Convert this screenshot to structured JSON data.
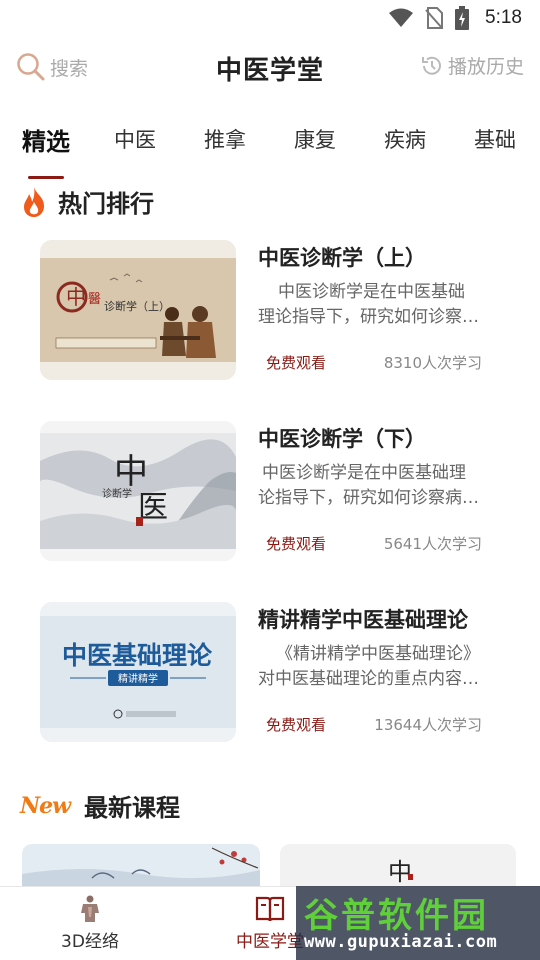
{
  "status_bar": {
    "time": "5:18",
    "icons": [
      "wifi-icon",
      "no-sim-icon",
      "battery-icon"
    ]
  },
  "header": {
    "search_label": "搜索",
    "title": "中医学堂",
    "history_label": "播放历史"
  },
  "tabs": [
    {
      "label": "精选",
      "active": true
    },
    {
      "label": "中医"
    },
    {
      "label": "推拿"
    },
    {
      "label": "康复"
    },
    {
      "label": "疾病"
    },
    {
      "label": "基础"
    }
  ],
  "hot": {
    "title": "热门排行",
    "icon": "fire-icon",
    "courses": [
      {
        "title": "中医诊断学（上）",
        "desc_line1": "中医诊断学是在中医基础",
        "desc_line2": "理论指导下，研究如何诊察…",
        "free_label": "免费观看",
        "count": "8310人次学习",
        "thumb_text": "诊断学（上）"
      },
      {
        "title": "中医诊断学（下）",
        "desc_line1": "中医诊断学是在中医基础理",
        "desc_line2": "论指导下，研究如何诊察病…",
        "free_label": "免费观看",
        "count": "5641人次学习",
        "thumb_text": "诊断学"
      },
      {
        "title": "精讲精学中医基础理论",
        "desc_line1": "《精讲精学中医基础理论》",
        "desc_line2": "对中医基础理论的重点内容…",
        "free_label": "免费观看",
        "count": "13644人次学习",
        "thumb_text": "中医基础理论",
        "thumb_sub": "精讲精学"
      }
    ]
  },
  "latest": {
    "badge": "New",
    "title": "最新课程"
  },
  "bottom_nav": [
    {
      "label": "3D经络",
      "icon": "body-icon"
    },
    {
      "label": "中医学堂",
      "icon": "book-icon",
      "active": true
    }
  ],
  "watermark": {
    "big": "谷普软件园",
    "small": "www.gupuxiazai.com"
  },
  "colors": {
    "accent": "#8b1a14",
    "fire": "#f05a1a",
    "new_badge": "#f07a14"
  }
}
